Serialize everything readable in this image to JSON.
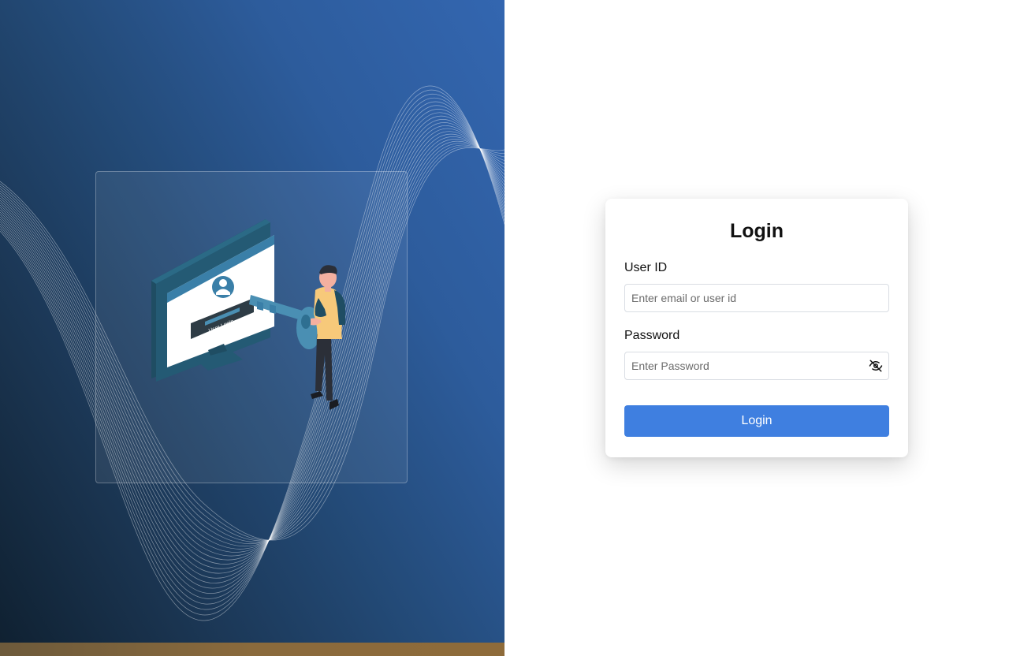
{
  "illustration": {
    "screen_button_text": "User Login",
    "colors": {
      "panel_dark": "#0f2030",
      "panel_light": "#3366b0",
      "monitor": "#1f4d63",
      "key": "#4a8fb3",
      "shirt": "#f7c97a"
    }
  },
  "login": {
    "title": "Login",
    "user_id": {
      "label": "User ID",
      "placeholder": "Enter email or user id",
      "value": ""
    },
    "password": {
      "label": "Password",
      "placeholder": "Enter Password",
      "value": "",
      "toggle_icon": "eye-slash-icon"
    },
    "submit_label": "Login",
    "accent_color": "#3f7fe0"
  }
}
